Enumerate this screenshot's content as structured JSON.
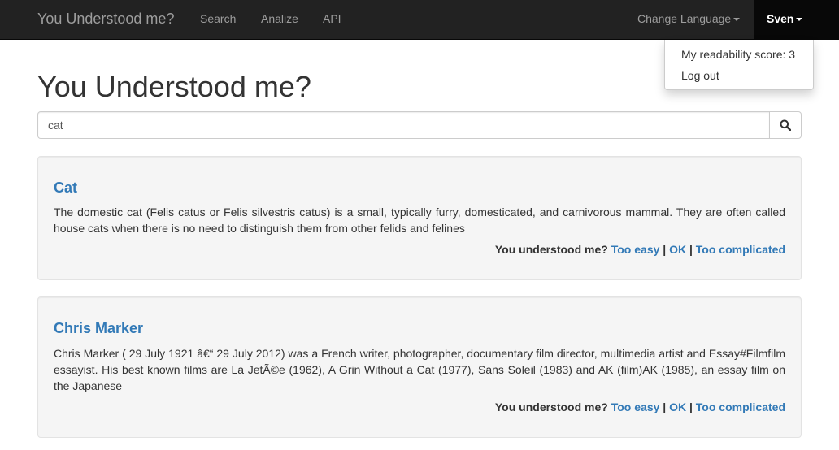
{
  "navbar": {
    "brand": "You Understood me?",
    "links": [
      "Search",
      "Analize",
      "API"
    ],
    "language_label": "Change Language",
    "user_name": "Sven"
  },
  "user_menu": {
    "items": [
      "My readability score: 3",
      "Log out"
    ]
  },
  "page": {
    "title": "You Understood me?"
  },
  "search": {
    "value": "cat",
    "button_icon": "search-icon"
  },
  "results": [
    {
      "title": "Cat",
      "text": "The domestic cat (Felis catus or Felis silvestris catus) is a small, typically furry, domesticated, and carnivorous mammal. They are often called house cats when there is no need to distinguish them from other felids and felines",
      "prompt": "You understood me?",
      "options": [
        "Too easy",
        "OK",
        "Too complicated"
      ],
      "separator": "|"
    },
    {
      "title": "Chris Marker",
      "text": "Chris Marker ( 29 July 1921 â€“ 29 July 2012) was a French writer, photographer, documentary film director, multimedia artist and Essay#Filmfilm essayist. His best known films are La JetÃ©e (1962), A Grin Without a Cat (1977), Sans Soleil (1983) and AK (film)AK (1985), an essay film on the Japanese",
      "prompt": "You understood me?",
      "options": [
        "Too easy",
        "OK",
        "Too complicated"
      ],
      "separator": "|"
    }
  ],
  "colors": {
    "navbar_bg": "#222222",
    "link": "#337ab7",
    "well_bg": "#f5f5f5"
  }
}
